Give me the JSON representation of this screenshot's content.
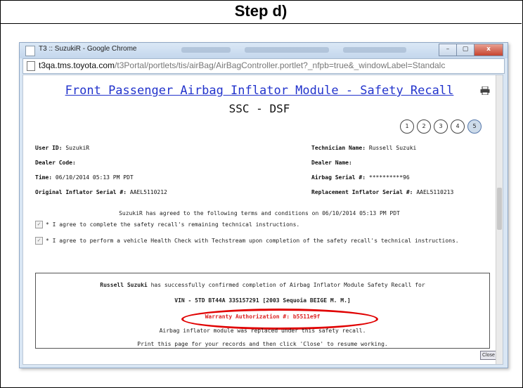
{
  "step_label": "Step d)",
  "window": {
    "title": "T3 :: SuzukiR - Google Chrome",
    "controls": [
      "–",
      "▢",
      "x"
    ],
    "url_host": "t3qa.tms.toyota.com",
    "url_path": "/t3Portal/portlets/tis/airBag/AirBagController.portlet?_nfpb=true&_windowLabel=Standalc"
  },
  "page": {
    "title": "Front Passenger Airbag Inflator Module - Safety Recall",
    "subtitle": "SSC - DSF",
    "print_icon": "printer-icon",
    "steps": [
      "1",
      "2",
      "3",
      "4",
      "5"
    ],
    "active_step": "5"
  },
  "fields": {
    "user_id_label": "User ID:",
    "user_id_value": "SuzukiR",
    "technician_label": "Technician Name:",
    "technician_value": "Russell Suzuki",
    "dealer_code_label": "Dealer Code:",
    "dealer_code_value": "",
    "dealer_name_label": "Dealer Name:",
    "dealer_name_value": "",
    "time_label": "Time:",
    "time_value": "06/10/2014 05:13 PM PDT",
    "airbag_serial_label": "Airbag Serial #:",
    "airbag_serial_value": "**********96",
    "orig_inflator_label": "Original Inflator Serial #:",
    "orig_inflator_value": "AAEL5110212",
    "repl_inflator_label": "Replacement Inflator Serial #:",
    "repl_inflator_value": "AAEL5110213"
  },
  "agreement": {
    "statement": "SuzukiR has agreed to the following terms and conditions on 06/10/2014 05:13 PM PDT",
    "item1": "* I agree to complete the safety recall's remaining technical instructions.",
    "item2": "* I agree to perform a vehicle Health Check with Techstream upon completion of the safety recall's technical instructions."
  },
  "confirmation": {
    "name": "Russell Suzuki",
    "line1_rest": "has successfully confirmed completion of Airbag Inflator Module Safety Recall for",
    "vin_line": "VIN -  5TD BT44A 33S157291 [2003 Sequoia BEIGE M. M.]",
    "warranty": "Warranty Authorization #:  b5511e9f",
    "replaced": "Airbag inflator module  was replaced under this safety recall.",
    "print_note": "Print this page for your records and then click 'Close' to resume working."
  },
  "close_button": "Close",
  "colors": {
    "link_blue": "#2233cc",
    "warranty_red": "#dd2222",
    "highlight_ellipse": "#e00000"
  }
}
